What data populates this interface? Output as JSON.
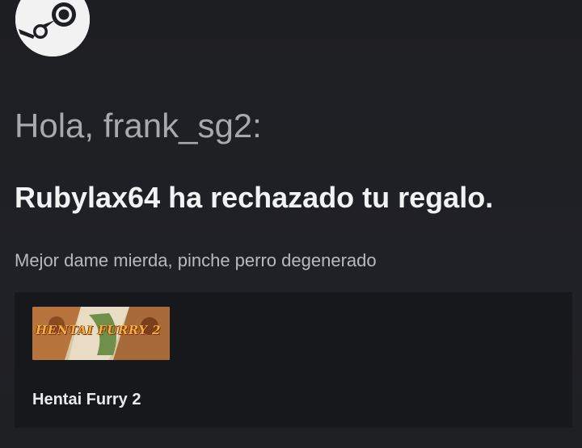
{
  "brand": {
    "logo_icon": "steam-logo-icon"
  },
  "email": {
    "greeting": "Hola, frank_sg2:",
    "headline": "Rubylax64 ha rechazado tu regalo.",
    "message": "Mejor dame mierda, pinche perro degenerado"
  },
  "gift": {
    "capsule_title": "HENTAI FURRY 2",
    "game_name": "Hentai Furry 2"
  },
  "colors": {
    "background": "#1e1f23",
    "card": "#17181c",
    "greeting_text": "#a8a9ad",
    "headline_text": "#f1f2f4"
  }
}
